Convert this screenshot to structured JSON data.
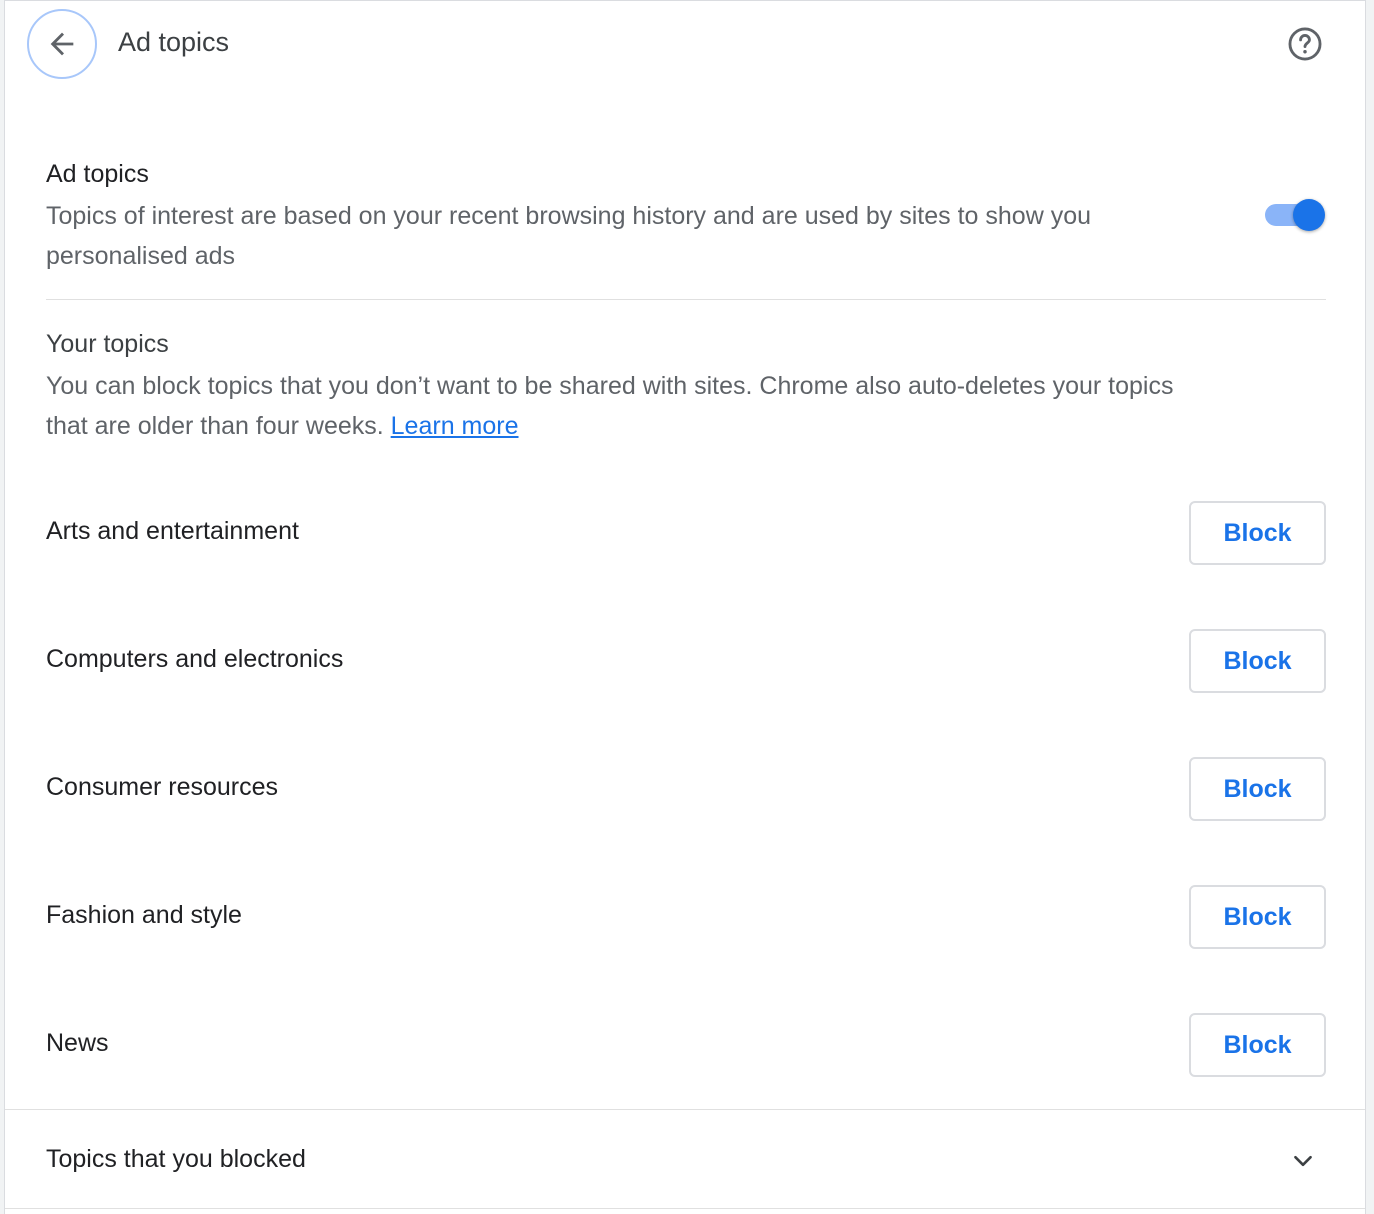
{
  "header": {
    "title": "Ad topics",
    "back_icon": "arrow-back-icon",
    "help_icon": "help-circle-icon"
  },
  "ad_topics": {
    "title": "Ad topics",
    "description_line1": "Topics of interest are based on your recent browsing history and are used by sites to show you",
    "description_line2": "personalised ads",
    "toggle_on": true
  },
  "your_topics": {
    "title": "Your topics",
    "description_line1": "You can block topics that you don’t want to be shared with sites. Chrome also auto-deletes your topics",
    "description_line2": "that are older than four weeks.",
    "learn_more": "Learn more"
  },
  "topics": [
    {
      "label": "Arts and entertainment",
      "action": "Block"
    },
    {
      "label": "Computers and electronics",
      "action": "Block"
    },
    {
      "label": "Consumer resources",
      "action": "Block"
    },
    {
      "label": "Fashion and style",
      "action": "Block"
    },
    {
      "label": "News",
      "action": "Block"
    }
  ],
  "blocked": {
    "label": "Topics that you blocked",
    "icon": "chevron-down-icon"
  },
  "colors": {
    "accent": "#1a73e8",
    "toggle_track": "#8ab4f8",
    "back_ring": "#a8c7fa"
  }
}
